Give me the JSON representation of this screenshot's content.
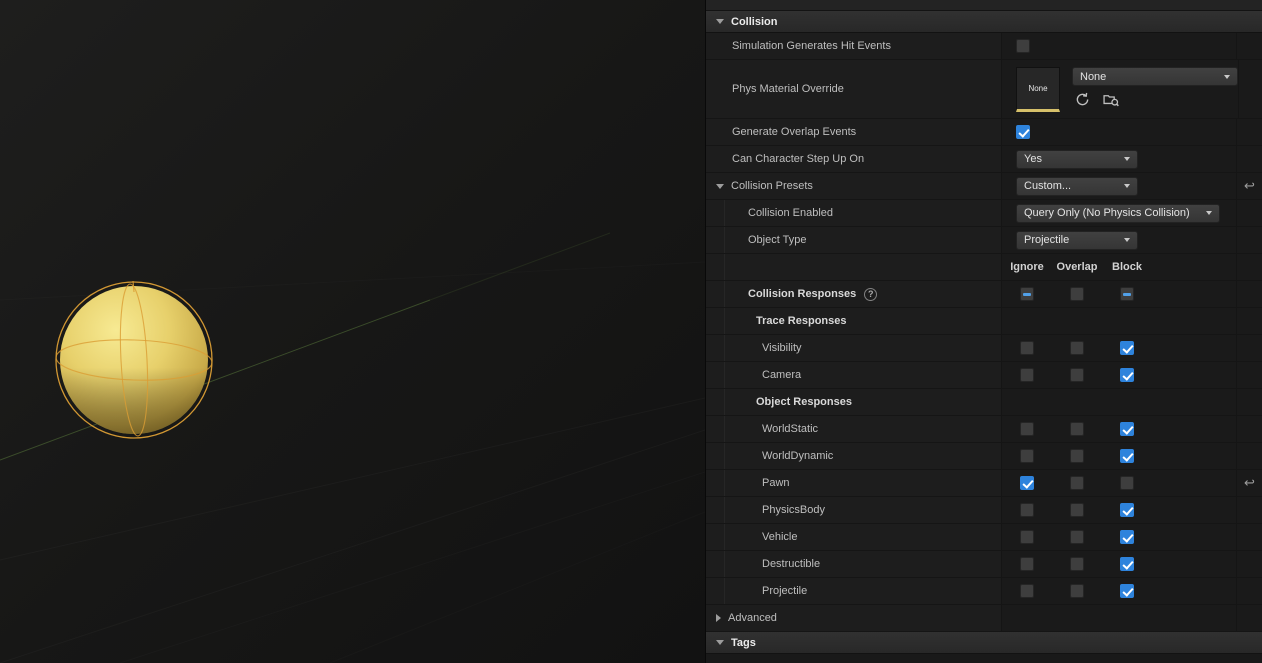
{
  "viewport": {
    "object": "sphere-actor",
    "sphere_color": "#e7d06b",
    "wire_color": "#db9e35"
  },
  "icons": {
    "revert_glyph": "↩",
    "help_glyph": "?"
  },
  "panel": {
    "rows": [
      {
        "label": "Collision"
      },
      {
        "label": "Simulation Generates Hit Events",
        "checkbox": "unchecked"
      },
      {
        "label": "Phys Material Override",
        "thumb_label": "None",
        "dropdown": "None"
      },
      {
        "label": "Generate Overlap Events",
        "checkbox": "checked"
      },
      {
        "label": "Can Character Step Up On",
        "dropdown": "Yes"
      },
      {
        "label": "Collision Presets",
        "dropdown": "Custom..."
      },
      {
        "label": "Collision Enabled",
        "dropdown": "Query Only (No Physics Collision)"
      },
      {
        "label": "Object Type",
        "dropdown": "Projectile"
      },
      {
        "cols": [
          "Ignore",
          "Overlap",
          "Block"
        ]
      },
      {
        "label": "Collision Responses",
        "cells": [
          "dash",
          "unchecked",
          "dash"
        ]
      },
      {
        "label": "Trace Responses"
      },
      {
        "label": "Visibility",
        "cells": [
          "unchecked",
          "unchecked",
          "checked"
        ]
      },
      {
        "label": "Camera",
        "cells": [
          "unchecked",
          "unchecked",
          "checked"
        ]
      },
      {
        "label": "Object Responses"
      },
      {
        "label": "WorldStatic",
        "cells": [
          "unchecked",
          "unchecked",
          "checked"
        ]
      },
      {
        "label": "WorldDynamic",
        "cells": [
          "unchecked",
          "unchecked",
          "checked"
        ]
      },
      {
        "label": "Pawn",
        "cells": [
          "checked",
          "unchecked",
          "unchecked"
        ]
      },
      {
        "label": "PhysicsBody",
        "cells": [
          "unchecked",
          "unchecked",
          "checked"
        ]
      },
      {
        "label": "Vehicle",
        "cells": [
          "unchecked",
          "unchecked",
          "checked"
        ]
      },
      {
        "label": "Destructible",
        "cells": [
          "unchecked",
          "unchecked",
          "checked"
        ]
      },
      {
        "label": "Projectile",
        "cells": [
          "unchecked",
          "unchecked",
          "checked"
        ]
      },
      {
        "label": "Advanced"
      },
      {
        "label": "Tags"
      }
    ]
  }
}
